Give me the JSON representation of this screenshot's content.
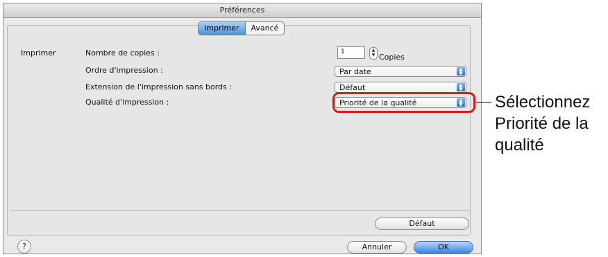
{
  "window": {
    "title": "Préférences"
  },
  "tabs": [
    {
      "label": "Imprimer",
      "active": true
    },
    {
      "label": "Avancé",
      "active": false
    }
  ],
  "section_label": "Imprimer",
  "fields": {
    "copies": {
      "label": "Nombre de copies :",
      "value": "1",
      "unit": "Copies"
    },
    "order": {
      "label": "Ordre d'impression :",
      "value": "Par date"
    },
    "extension": {
      "label": "Extension de l'impression sans bords :",
      "value": "Défaut"
    },
    "quality": {
      "label": "Qualité d'impression :",
      "value": "Priorité de la qualité"
    }
  },
  "buttons": {
    "default": "Défaut",
    "cancel": "Annuler",
    "ok": "OK",
    "help": "?"
  },
  "annotation": {
    "line1": "Sélectionnez",
    "line2": "Priorité de la",
    "line3": "qualité"
  },
  "colors": {
    "highlight": "#e3161b",
    "accent": "#3b86e0"
  }
}
